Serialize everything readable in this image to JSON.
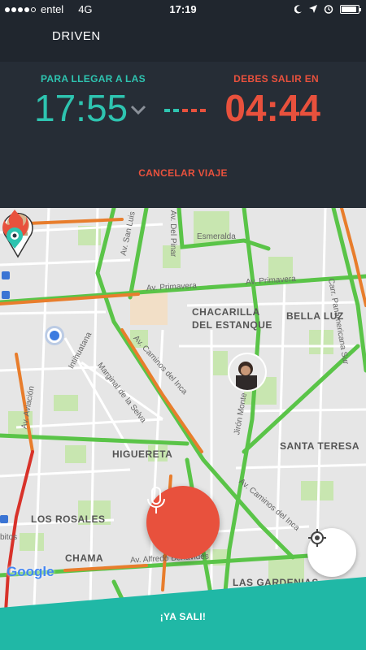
{
  "status_bar": {
    "carrier": "entel",
    "network": "4G",
    "time": "17:19"
  },
  "header": {
    "title": "DRIVEN"
  },
  "trip": {
    "arrive_label": "PARA LLEGAR A LAS",
    "arrive_time": "17:55",
    "leave_label": "DEBES SALIR EN",
    "leave_time": "04:44",
    "cancel_label": "CANCELAR VIAJE"
  },
  "map": {
    "areas": [
      "CHACARILLA DEL ESTANQUE",
      "BELLA LUZ",
      "HIGUERETA",
      "SANTA TERESA",
      "LOS ROSALES",
      "CHAMA",
      "LAS GARDENIAS"
    ],
    "streets": [
      "Av. San Luis",
      "Av. Del Pinar",
      "Esmeralda",
      "Av. Primavera",
      "Av. Primavera",
      "Av. Caminos del Inca",
      "Marginal de la Selva",
      "Intihuatana",
      "Av. Aviación",
      "Jirón Monte",
      "Av. Caminos del Inca",
      "Av. Alfredo Benavides",
      "Carr. Panamericana Sur",
      "bitos"
    ],
    "attribution": "Google"
  },
  "actions": {
    "ya_sali_label": "¡YA SALI!"
  },
  "colors": {
    "accent_teal": "#2ec4b0",
    "accent_red": "#e8513d",
    "header_bg": "#20262e",
    "panel_bg": "#262d36"
  },
  "icons": {
    "chevron": "chevron-down-icon",
    "mic": "microphone-icon",
    "locate": "crosshair-icon",
    "fire": "fire-pin-icon"
  }
}
